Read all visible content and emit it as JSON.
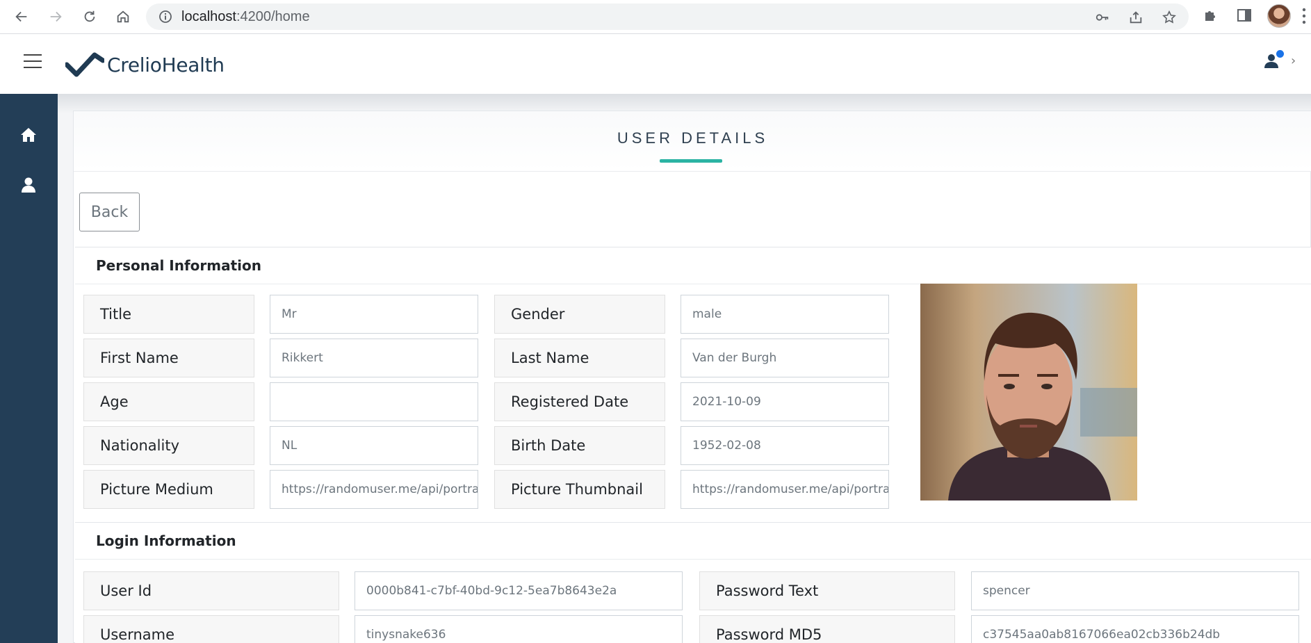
{
  "browser": {
    "url_host": "localhost",
    "url_path": ":4200/home"
  },
  "header": {
    "logo_text": "CrelioHealth",
    "chevron": "›"
  },
  "card": {
    "title": "USER DETAILS",
    "back_label": "Back"
  },
  "personal": {
    "heading": "Personal Information",
    "fields": {
      "title": {
        "label": "Title",
        "value": "Mr"
      },
      "gender": {
        "label": "Gender",
        "value": "male"
      },
      "first_name": {
        "label": "First Name",
        "value": "Rikkert"
      },
      "last_name": {
        "label": "Last Name",
        "value": "Van der Burgh"
      },
      "age": {
        "label": "Age",
        "value": ""
      },
      "registered_date": {
        "label": "Registered Date",
        "value": "2021-10-09"
      },
      "nationality": {
        "label": "Nationality",
        "value": "NL"
      },
      "birth_date": {
        "label": "Birth Date",
        "value": "1952-02-08"
      },
      "picture_medium": {
        "label": "Picture Medium",
        "value": "https://randomuser.me/api/portra"
      },
      "picture_thumbnail": {
        "label": "Picture Thumbnail",
        "value": "https://randomuser.me/api/portra"
      }
    }
  },
  "login": {
    "heading": "Login Information",
    "fields": {
      "user_id": {
        "label": "User Id",
        "value": "0000b841-c7bf-40bd-9c12-5ea7b8643e2a"
      },
      "password_text": {
        "label": "Password Text",
        "value": "spencer"
      },
      "username": {
        "label": "Username",
        "value": "tinysnake636"
      },
      "password_md5": {
        "label": "Password MD5",
        "value": "c37545aa0ab8167066ea02cb336b24db"
      }
    }
  },
  "colors": {
    "sidebar": "#233e57",
    "accent": "#2bb3a3",
    "notification": "#1a73e8"
  },
  "icons": [
    "back-arrow-icon",
    "forward-arrow-icon",
    "reload-icon",
    "home-icon",
    "info-icon",
    "key-icon",
    "share-icon",
    "star-icon",
    "puzzle-icon",
    "side-panel-icon",
    "user-icon",
    "home-icon",
    "person-icon"
  ]
}
